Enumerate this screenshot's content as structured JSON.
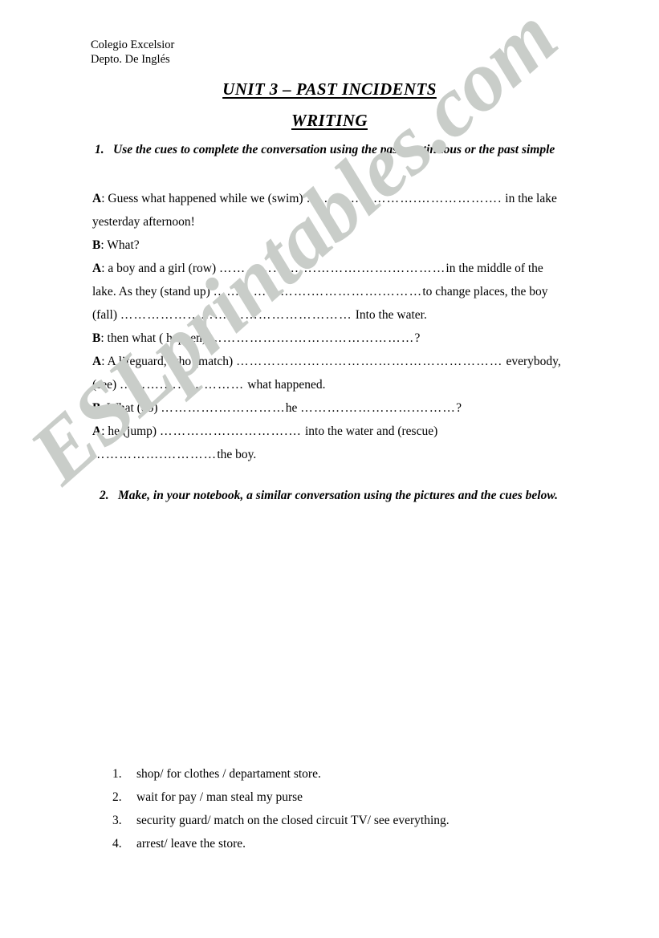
{
  "document": {
    "title": "UNIT 3 – PAST INCIDENTS",
    "subtitle": "WRITING"
  },
  "school_header": {
    "line1": "Colegio Excelsior",
    "line2": "Depto. De Inglés"
  },
  "tasks": [
    {
      "number": "1.",
      "text": "Use the cues to complete the conversation using the past continuous or the past simple"
    },
    {
      "number": "2.",
      "text": "Make, in your notebook,  a similar conversation using the pictures and the cues below."
    }
  ],
  "dialogue": [
    {
      "speaker": "A",
      "segments": [
        {
          "type": "text",
          "value": ": Guess what happened while we (swim) "
        },
        {
          "type": "dots",
          "value": "…………………….………………."
        },
        {
          "type": "text",
          "value": " in the lake yesterday afternoon!"
        }
      ]
    },
    {
      "speaker": "B",
      "segments": [
        {
          "type": "text",
          "value": ": What?"
        }
      ]
    },
    {
      "speaker": "A",
      "segments": [
        {
          "type": "text",
          "value": ": a boy and a girl (row) "
        },
        {
          "type": "dots",
          "value": "………………….……….…….…………"
        },
        {
          "type": "text",
          "value": "in the middle of the lake. As they (stand up) "
        },
        {
          "type": "dots",
          "value": "………………….…………….………"
        },
        {
          "type": "text",
          "value": "to change places, the boy (fall) "
        },
        {
          "type": "dots",
          "value": "…………………….………………………"
        },
        {
          "type": "text",
          "value": " Into the water."
        }
      ]
    },
    {
      "speaker": "B",
      "segments": [
        {
          "type": "text",
          "value": ": then what ( happen) "
        },
        {
          "type": "dots",
          "value": "……………….………………………"
        },
        {
          "type": "text",
          "value": "?"
        }
      ]
    },
    {
      "speaker": "A",
      "segments": [
        {
          "type": "text",
          "value": ": A lifeguard, who (match) "
        },
        {
          "type": "dots",
          "value": "…………….…………….…….…………………"
        },
        {
          "type": "text",
          "value": " everybody, (see) "
        },
        {
          "type": "dots",
          "value": "……….………………"
        },
        {
          "type": "text",
          "value": " what happened."
        }
      ]
    },
    {
      "speaker": "B",
      "segments": [
        {
          "type": "text",
          "value": ": What (do) "
        },
        {
          "type": "dots",
          "value": "………….……………"
        },
        {
          "type": "text",
          "value": "he "
        },
        {
          "type": "dots",
          "value": "……….…………….………"
        },
        {
          "type": "text",
          "value": "?"
        }
      ]
    },
    {
      "speaker": "A",
      "segments": [
        {
          "type": "text",
          "value": ": he (jump) "
        },
        {
          "type": "dots",
          "value": "…………….………….…"
        },
        {
          "type": "text",
          "value": " into the water and (rescue) "
        },
        {
          "type": "dots",
          "value": "…………….…………"
        },
        {
          "type": "text",
          "value": "the boy."
        }
      ]
    }
  ],
  "cue_list": [
    {
      "number": "1.",
      "text": "shop/ for clothes / departament store."
    },
    {
      "number": "2.",
      "text": "wait for pay / man steal my purse"
    },
    {
      "number": "3.",
      "text": "security guard/ match on the closed circuit TV/ see everything."
    },
    {
      "number": "4.",
      "text": "arrest/ leave the store."
    }
  ],
  "watermark": {
    "text": "ESLprintables.com",
    "color": "#c9cdc9"
  },
  "colors": {
    "page_background": "#ffffff",
    "text": "#000000"
  }
}
